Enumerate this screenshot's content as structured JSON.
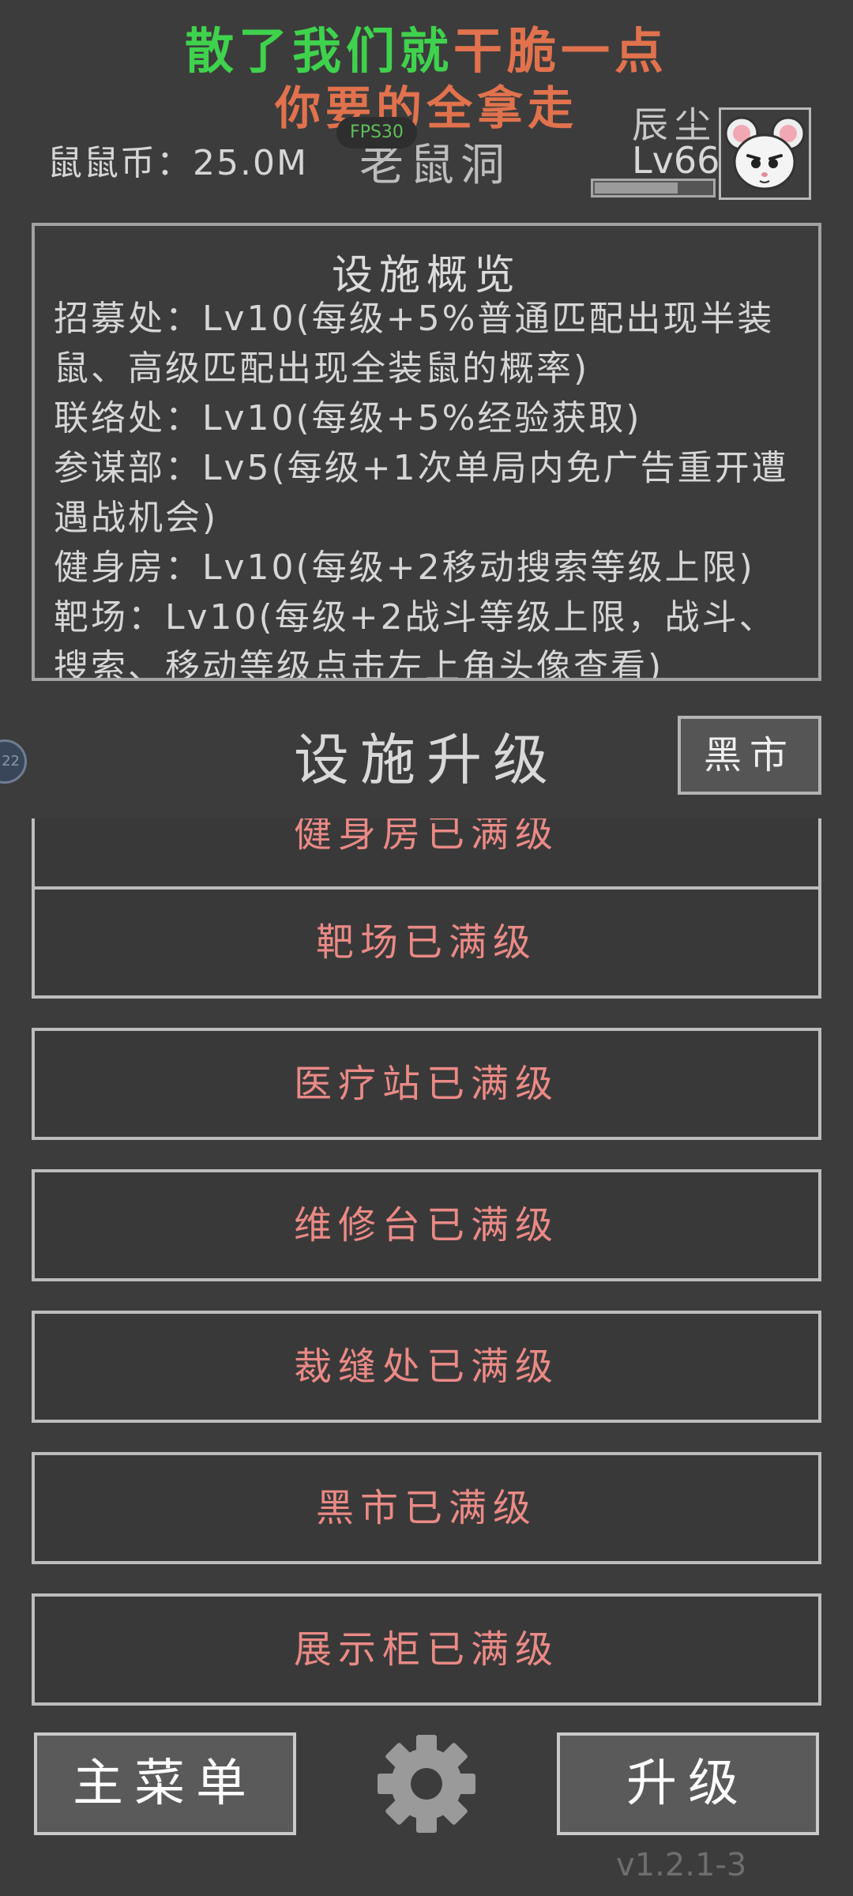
{
  "banner": {
    "line1_green": "散了我们就",
    "line1_orange": "干脆一点",
    "line2": "你要的全拿走"
  },
  "header": {
    "coins_label": "鼠鼠币：",
    "coins_value": "25.0M",
    "fps": "FPS30",
    "place": "老鼠洞",
    "player_name": "辰尘",
    "player_level": "Lv66",
    "xp_fraction": 0.72
  },
  "overview": {
    "title": "设施概览",
    "items": [
      "招募处：Lv10(每级+5%普通匹配出现半装鼠、高级匹配出现全装鼠的概率)",
      "联络处：Lv10(每级+5%经验获取)",
      "参谋部：Lv5(每级+1次单局内免广告重开遭遇战机会)",
      "健身房：Lv10(每级+2移动搜索等级上限)",
      "靶场：Lv10(每级+2战斗等级上限，战斗、搜索、移动等级点击左上角头像查看)"
    ]
  },
  "upgrade": {
    "title": "设施升级",
    "market_button": "黑市",
    "side_badge": "22",
    "facilities": [
      "健身房已满级",
      "靶场已满级",
      "医疗站已满级",
      "维修台已满级",
      "裁缝处已满级",
      "黑市已满级",
      "展示柜已满级"
    ]
  },
  "footer": {
    "main_menu": "主菜单",
    "upgrade": "升级",
    "version": "v1.2.1-3"
  },
  "colors": {
    "background": "#3c3c3c",
    "banner_green": "#3fd24d",
    "banner_orange": "#e1724d",
    "maxed_text": "#ea8a86"
  },
  "icons": {
    "settings": "gear-icon",
    "avatar": "mouse-avatar"
  }
}
